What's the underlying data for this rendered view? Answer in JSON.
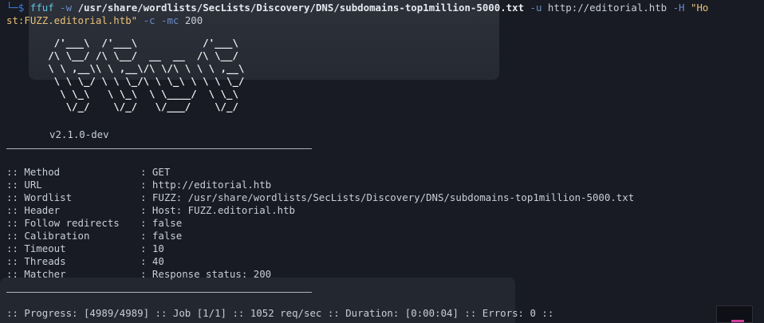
{
  "command": {
    "prompt_glyph": "└─$",
    "program": "ffuf",
    "flag_w": "-w",
    "wordlist_path": "/usr/share/wordlists/SecLists/Discovery/DNS/subdomains-top1million-5000.txt",
    "flag_u": "-u",
    "url": "http://editorial.htb",
    "flag_H": "-H",
    "header_part1": "\"Ho",
    "header_part2": "st:FUZZ.editorial.htb\"",
    "flag_c": "-c",
    "flag_mc": "-mc",
    "mc_value": "200"
  },
  "banner": {
    "ascii": "        /'___\\  /'___\\           /'___\\\n       /\\ \\__/ /\\ \\__/  __  __  /\\ \\__/\n       \\ \\ ,__\\\\ \\ ,__\\/\\ \\/\\ \\ \\ \\ ,__\\\n        \\ \\ \\_/ \\ \\ \\_/\\ \\ \\_\\ \\ \\ \\ \\_/\n         \\ \\_\\   \\ \\_\\  \\ \\____/  \\ \\_\\\n          \\/_/    \\/_/   \\/___/    \\/_/",
    "version": "v2.1.0-dev"
  },
  "config": [
    {
      "key": ":: Method",
      "value": ": GET"
    },
    {
      "key": ":: URL",
      "value": ": http://editorial.htb"
    },
    {
      "key": ":: Wordlist",
      "value": ": FUZZ: /usr/share/wordlists/SecLists/Discovery/DNS/subdomains-top1million-5000.txt"
    },
    {
      "key": ":: Header",
      "value": ": Host: FUZZ.editorial.htb"
    },
    {
      "key": ":: Follow redirects",
      "value": ": false"
    },
    {
      "key": ":: Calibration",
      "value": ": false"
    },
    {
      "key": ":: Timeout",
      "value": ": 10"
    },
    {
      "key": ":: Threads",
      "value": ": 40"
    },
    {
      "key": ":: Matcher",
      "value": ": Response status: 200"
    }
  ],
  "progress": {
    "text": ":: Progress: [4989/4989] :: Job [1/1] :: 1052 req/sec :: Duration: [0:00:04] :: Errors: 0 ::"
  },
  "colors": {
    "background": "#181b23",
    "program": "#5cc6e2",
    "flag": "#6a8cc9",
    "string": "#e7c177",
    "text": "#c9cdd6"
  }
}
